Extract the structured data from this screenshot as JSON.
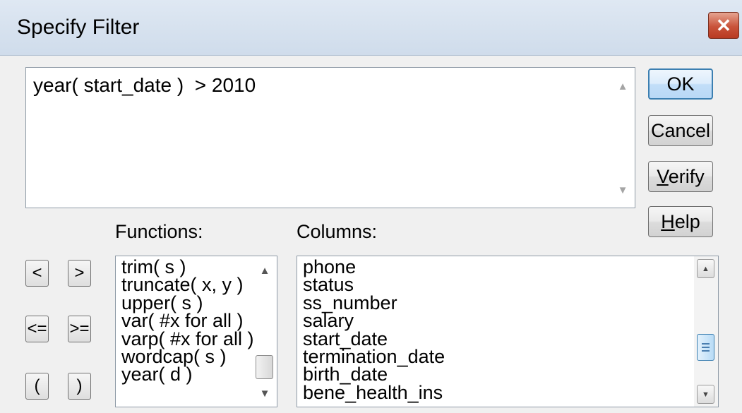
{
  "window": {
    "title": "Specify Filter",
    "close_glyph": "✕"
  },
  "expression": {
    "value": "year( start_date )  > 2010"
  },
  "buttons": {
    "ok": "OK",
    "cancel": "Cancel",
    "verify_mnemonic": "V",
    "verify_rest": "erify",
    "help_mnemonic": "H",
    "help_rest": "elp"
  },
  "labels": {
    "functions": "Functions:",
    "columns": "Columns:"
  },
  "operators": [
    "<",
    ">",
    "<=",
    ">=",
    "(",
    ")"
  ],
  "functions": [
    "trim( s )",
    "truncate( x, y )",
    "upper( s )",
    "var( #x for all )",
    "varp( #x for all )",
    "wordcap( s )",
    "year( d )"
  ],
  "columns": [
    "phone",
    "status",
    "ss_number",
    "salary",
    "start_date",
    "termination_date",
    "birth_date",
    "bene_health_ins"
  ],
  "colors": {
    "accent": "#3c7fb1",
    "close_button": "#c9533a"
  },
  "icons": [
    "close-icon",
    "scroll-up-arrow-icon",
    "scroll-down-arrow-icon"
  ]
}
